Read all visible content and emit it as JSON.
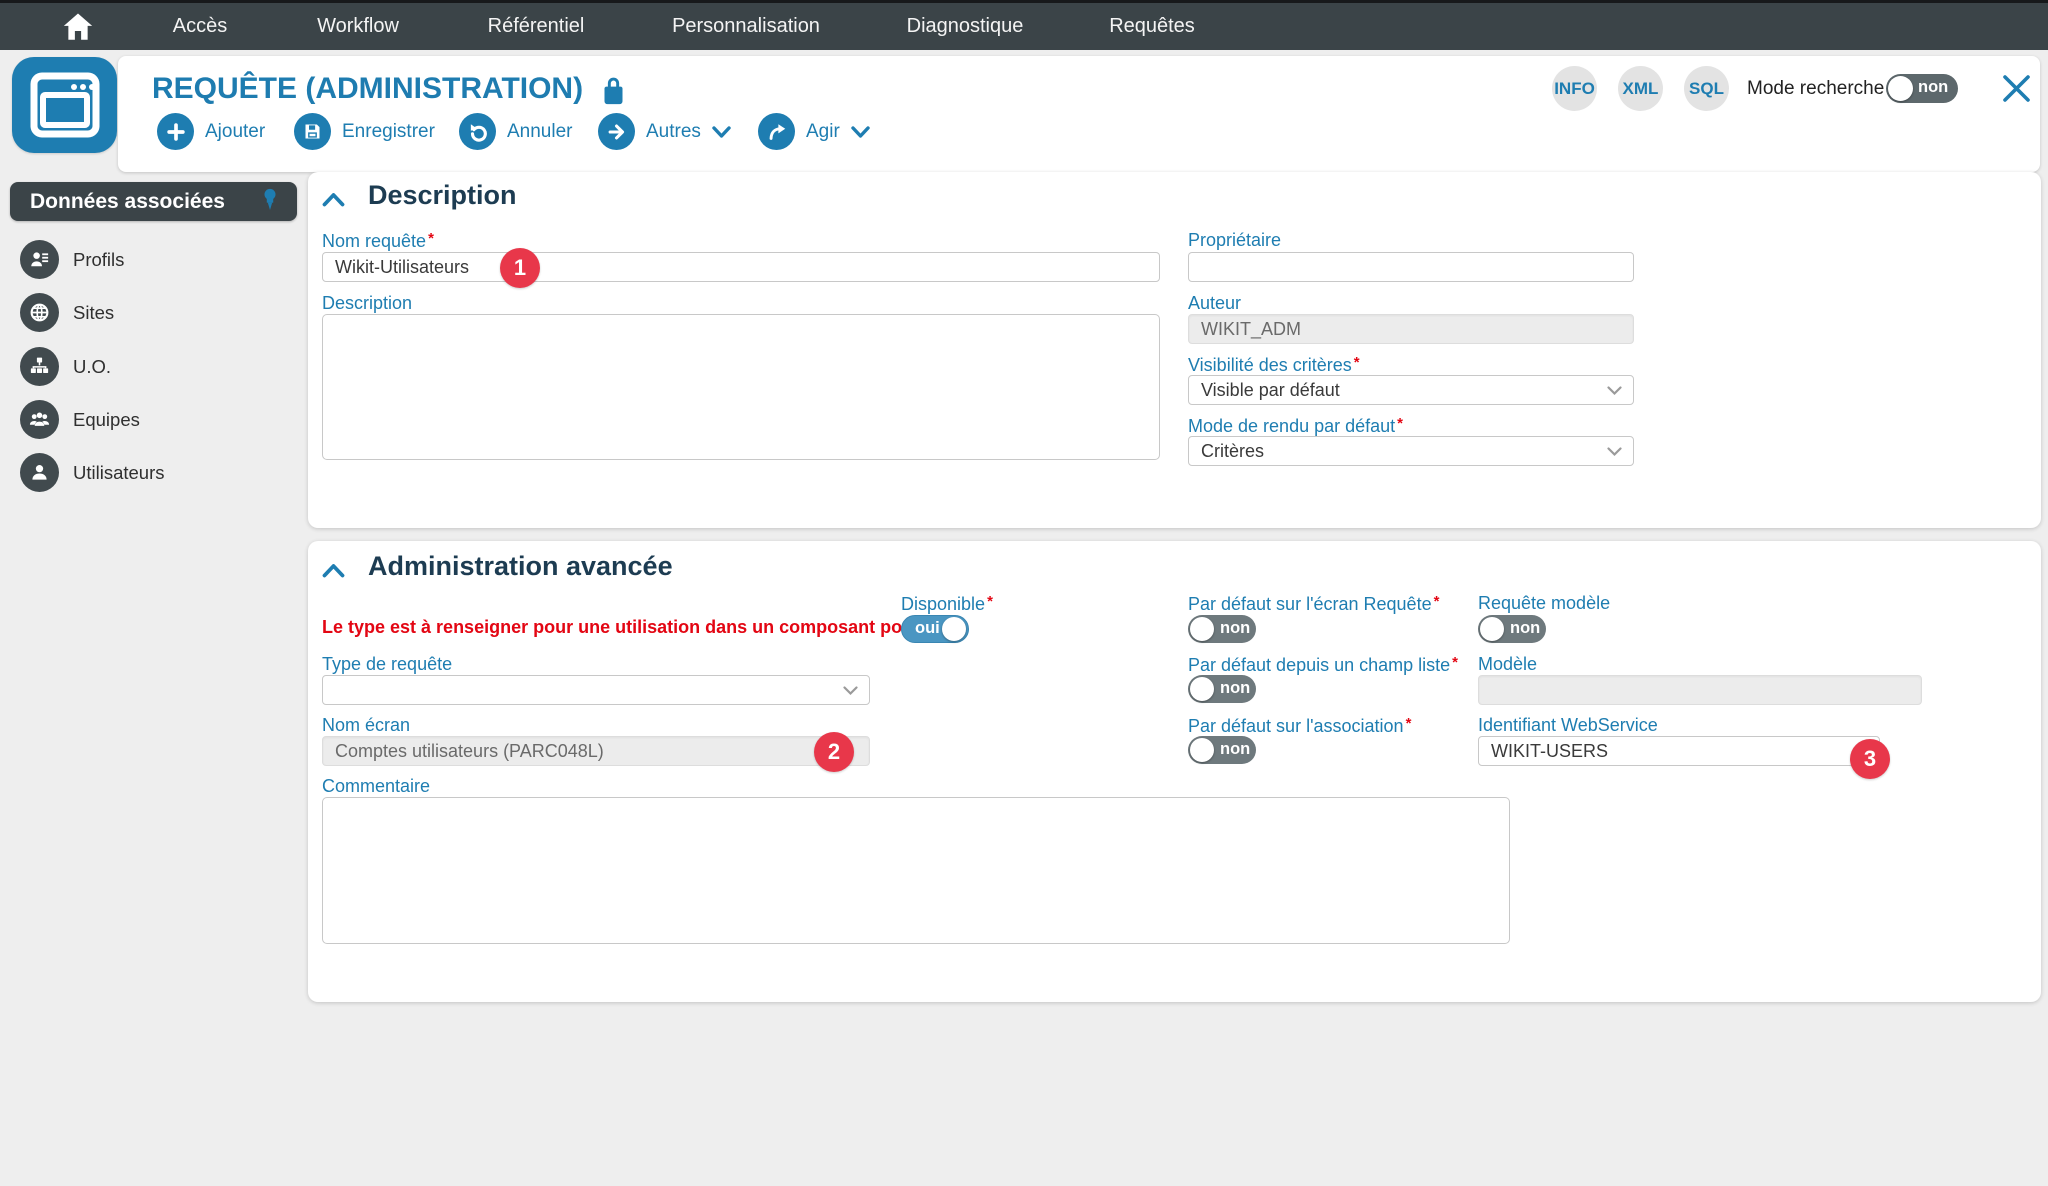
{
  "nav": {
    "items": [
      "Accès",
      "Workflow",
      "Référentiel",
      "Personnalisation",
      "Diagnostique",
      "Requêtes"
    ]
  },
  "header": {
    "title": "REQUÊTE (ADMINISTRATION)",
    "toolbar": {
      "ajouter": "Ajouter",
      "enregistrer": "Enregistrer",
      "annuler": "Annuler",
      "autres": "Autres",
      "agir": "Agir"
    },
    "meta_buttons": {
      "info": "INFO",
      "xml": "XML",
      "sql": "SQL"
    },
    "mode_recherche": {
      "label": "Mode recherche",
      "value": "non"
    }
  },
  "sidebar": {
    "title": "Données associées",
    "items": [
      {
        "label": "Profils",
        "icon": "profile-icon"
      },
      {
        "label": "Sites",
        "icon": "globe-icon"
      },
      {
        "label": "U.O.",
        "icon": "org-icon"
      },
      {
        "label": "Equipes",
        "icon": "team-icon"
      },
      {
        "label": "Utilisateurs",
        "icon": "user-icon"
      }
    ]
  },
  "description": {
    "title": "Description",
    "nom_requete": {
      "label": "Nom requête",
      "required": true,
      "value": "Wikit-Utilisateurs"
    },
    "description": {
      "label": "Description",
      "value": ""
    },
    "proprietaire": {
      "label": "Propriétaire",
      "value": ""
    },
    "auteur": {
      "label": "Auteur",
      "value": "WIKIT_ADM",
      "disabled": true
    },
    "visibilite": {
      "label": "Visibilité des critères",
      "required": true,
      "value": "Visible par défaut"
    },
    "mode_rendu": {
      "label": "Mode de rendu par défaut",
      "required": true,
      "value": "Critères"
    }
  },
  "admin": {
    "title": "Administration avancée",
    "warning": "Le type est à renseigner pour une utilisation dans un composant por...",
    "type_requete": {
      "label": "Type de requête",
      "value": ""
    },
    "nom_ecran": {
      "label": "Nom écran",
      "value": "Comptes utilisateurs (PARC048L)",
      "disabled": true
    },
    "commentaire": {
      "label": "Commentaire",
      "value": ""
    },
    "disponible": {
      "label": "Disponible",
      "required": true,
      "value": "oui",
      "state": "on"
    },
    "defaut_ecran": {
      "label": "Par défaut sur l'écran Requête",
      "required": true,
      "value": "non",
      "state": "off"
    },
    "defaut_champ": {
      "label": "Par défaut depuis un champ liste",
      "required": true,
      "value": "non",
      "state": "off"
    },
    "defaut_assoc": {
      "label": "Par défaut sur l'association",
      "required": true,
      "value": "non",
      "state": "off"
    },
    "requete_modele": {
      "label": "Requête modèle",
      "value": "non",
      "state": "off"
    },
    "modele": {
      "label": "Modèle",
      "value": "",
      "disabled": true
    },
    "identifiant_ws": {
      "label": "Identifiant WebService",
      "value": "WIKIT-USERS"
    }
  },
  "badges": {
    "b1": "1",
    "b2": "2",
    "b3": "3"
  },
  "ui": {
    "required_marker": "*"
  },
  "colors": {
    "accent": "#1e7db1",
    "nav_bg": "#3b4448",
    "badge_red": "#e8374a",
    "warning_red": "#e30613",
    "toggle_off": "#6e797d",
    "toggle_on": "#4a96c2"
  }
}
